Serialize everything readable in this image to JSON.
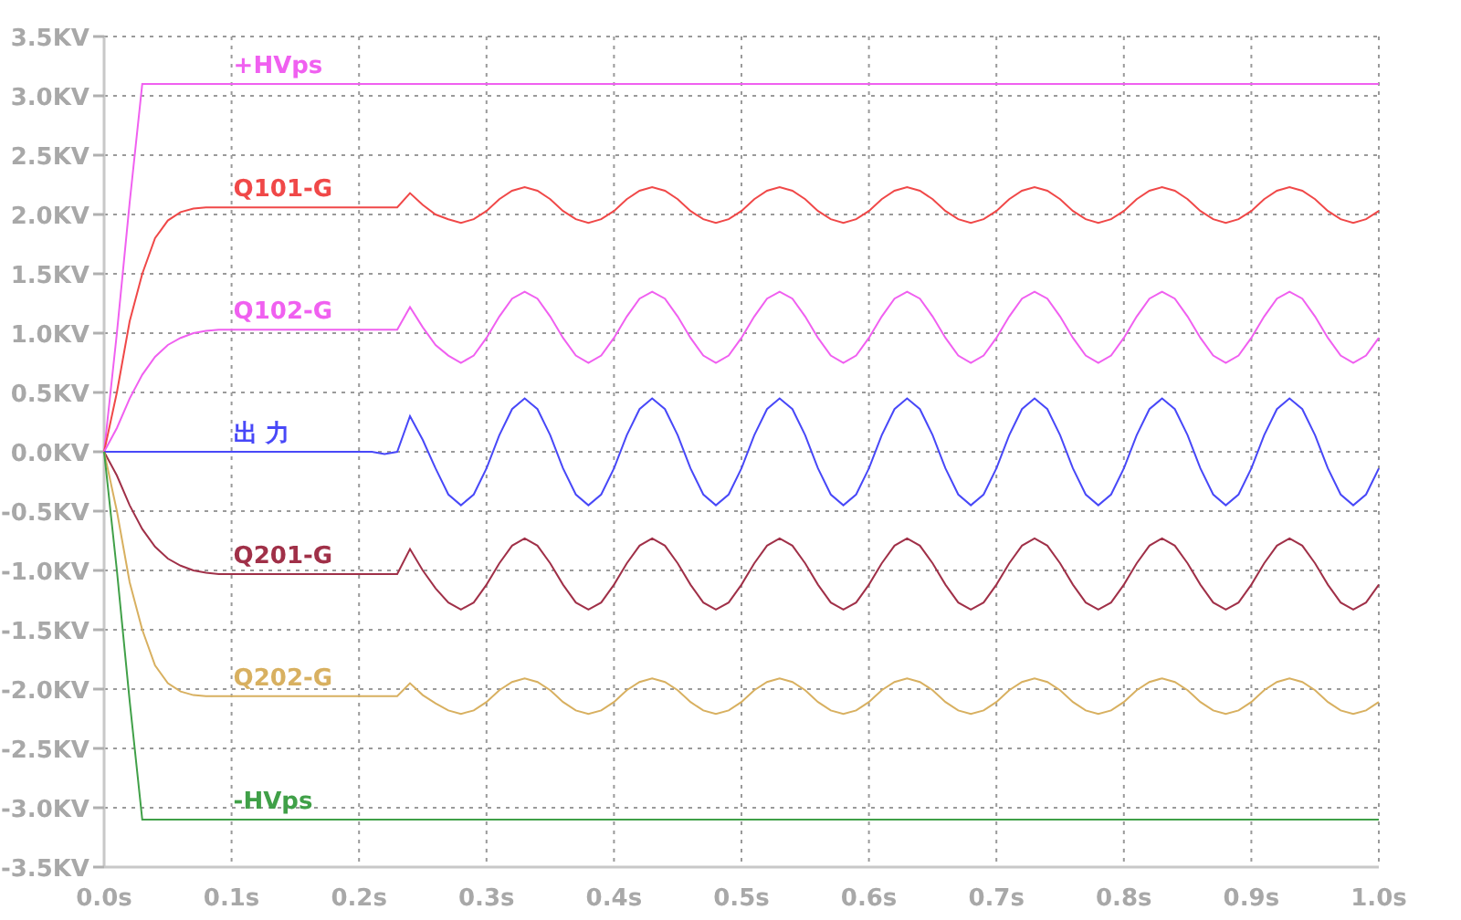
{
  "plot": {
    "chart_data": {
      "type": "line",
      "x": [
        0,
        0.01,
        0.02,
        0.03,
        0.04,
        0.05,
        0.06,
        0.07,
        0.08,
        0.09,
        0.1,
        0.11,
        0.12,
        0.13,
        0.14,
        0.15,
        0.16,
        0.17,
        0.18,
        0.19,
        0.2,
        0.21,
        0.22,
        0.23,
        0.24,
        0.25,
        0.26,
        0.27,
        0.28,
        0.29,
        0.3,
        0.31,
        0.32,
        0.33,
        0.34,
        0.35,
        0.36,
        0.37,
        0.38,
        0.39,
        0.4,
        0.41,
        0.42,
        0.43,
        0.44,
        0.45,
        0.46,
        0.47,
        0.48,
        0.49,
        0.5,
        0.51,
        0.52,
        0.53,
        0.54,
        0.55,
        0.56,
        0.57,
        0.58,
        0.59,
        0.6,
        0.61,
        0.62,
        0.63,
        0.64,
        0.65,
        0.66,
        0.67,
        0.68,
        0.69,
        0.7,
        0.71,
        0.72,
        0.73,
        0.74,
        0.75,
        0.76,
        0.77,
        0.78,
        0.79,
        0.8,
        0.81,
        0.82,
        0.83,
        0.84,
        0.85,
        0.86,
        0.87,
        0.88,
        0.89,
        0.9,
        0.91,
        0.92,
        0.93,
        0.94,
        0.95,
        0.96,
        0.97,
        0.98,
        0.99,
        1.0
      ],
      "series": [
        {
          "name": "+HVps",
          "color": "#f060f0",
          "values": [
            0,
            1.0,
            2.1,
            3.1,
            3.1,
            3.1,
            3.1,
            3.1,
            3.1,
            3.1,
            3.1,
            3.1,
            3.1,
            3.1,
            3.1,
            3.1,
            3.1,
            3.1,
            3.1,
            3.1,
            3.1,
            3.1,
            3.1,
            3.1,
            3.1,
            3.1,
            3.1,
            3.1,
            3.1,
            3.1,
            3.1,
            3.1,
            3.1,
            3.1,
            3.1,
            3.1,
            3.1,
            3.1,
            3.1,
            3.1,
            3.1,
            3.1,
            3.1,
            3.1,
            3.1,
            3.1,
            3.1,
            3.1,
            3.1,
            3.1,
            3.1,
            3.1,
            3.1,
            3.1,
            3.1,
            3.1,
            3.1,
            3.1,
            3.1,
            3.1,
            3.1,
            3.1,
            3.1,
            3.1,
            3.1,
            3.1,
            3.1,
            3.1,
            3.1,
            3.1,
            3.1,
            3.1,
            3.1,
            3.1,
            3.1,
            3.1,
            3.1,
            3.1,
            3.1,
            3.1,
            3.1,
            3.1,
            3.1,
            3.1,
            3.1,
            3.1,
            3.1,
            3.1,
            3.1,
            3.1,
            3.1,
            3.1,
            3.1,
            3.1,
            3.1,
            3.1,
            3.1,
            3.1,
            3.1,
            3.1,
            3.1
          ]
        },
        {
          "name": "Q101-G",
          "color": "#f04848",
          "values": [
            0,
            0.5,
            1.1,
            1.5,
            1.8,
            1.95,
            2.02,
            2.05,
            2.06,
            2.06,
            2.06,
            2.06,
            2.06,
            2.06,
            2.06,
            2.06,
            2.06,
            2.06,
            2.06,
            2.06,
            2.06,
            2.06,
            2.06,
            2.06,
            2.18,
            2.08,
            2.0,
            1.96,
            1.93,
            1.96,
            2.03,
            2.13,
            2.2,
            2.23,
            2.2,
            2.13,
            2.03,
            1.96,
            1.93,
            1.96,
            2.03,
            2.13,
            2.2,
            2.23,
            2.2,
            2.13,
            2.03,
            1.96,
            1.93,
            1.96,
            2.03,
            2.13,
            2.2,
            2.23,
            2.2,
            2.13,
            2.03,
            1.96,
            1.93,
            1.96,
            2.03,
            2.13,
            2.2,
            2.23,
            2.2,
            2.13,
            2.03,
            1.96,
            1.93,
            1.96,
            2.03,
            2.13,
            2.2,
            2.23,
            2.2,
            2.13,
            2.03,
            1.96,
            1.93,
            1.96,
            2.03,
            2.13,
            2.2,
            2.23,
            2.2,
            2.13,
            2.03,
            1.96,
            1.93,
            1.96,
            2.03,
            2.13,
            2.2,
            2.23,
            2.2,
            2.13,
            2.03,
            1.96,
            1.93,
            1.96,
            2.03
          ]
        },
        {
          "name": "Q102-G",
          "color": "#f060f0",
          "values": [
            0,
            0.2,
            0.45,
            0.65,
            0.8,
            0.9,
            0.96,
            1.0,
            1.02,
            1.03,
            1.03,
            1.03,
            1.03,
            1.03,
            1.03,
            1.03,
            1.03,
            1.03,
            1.03,
            1.03,
            1.03,
            1.03,
            1.03,
            1.03,
            1.22,
            1.05,
            0.9,
            0.81,
            0.75,
            0.81,
            0.96,
            1.14,
            1.29,
            1.35,
            1.29,
            1.14,
            0.96,
            0.81,
            0.75,
            0.81,
            0.96,
            1.14,
            1.29,
            1.35,
            1.29,
            1.14,
            0.96,
            0.81,
            0.75,
            0.81,
            0.96,
            1.14,
            1.29,
            1.35,
            1.29,
            1.14,
            0.96,
            0.81,
            0.75,
            0.81,
            0.96,
            1.14,
            1.29,
            1.35,
            1.29,
            1.14,
            0.96,
            0.81,
            0.75,
            0.81,
            0.96,
            1.14,
            1.29,
            1.35,
            1.29,
            1.14,
            0.96,
            0.81,
            0.75,
            0.81,
            0.96,
            1.14,
            1.29,
            1.35,
            1.29,
            1.14,
            0.96,
            0.81,
            0.75,
            0.81,
            0.96,
            1.14,
            1.29,
            1.35,
            1.29,
            1.14,
            0.96,
            0.81,
            0.75,
            0.81,
            0.96
          ]
        },
        {
          "name": "出 力",
          "color": "#4848f8",
          "values": [
            0,
            0,
            0,
            0,
            0,
            0,
            0,
            0,
            0,
            0,
            0,
            0,
            0,
            0,
            0,
            0,
            0,
            0,
            0,
            0,
            0,
            0,
            -0.02,
            0,
            0.3,
            0.1,
            -0.14,
            -0.36,
            -0.45,
            -0.36,
            -0.14,
            0.14,
            0.36,
            0.45,
            0.36,
            0.14,
            -0.14,
            -0.36,
            -0.45,
            -0.36,
            -0.14,
            0.14,
            0.36,
            0.45,
            0.36,
            0.14,
            -0.14,
            -0.36,
            -0.45,
            -0.36,
            -0.14,
            0.14,
            0.36,
            0.45,
            0.36,
            0.14,
            -0.14,
            -0.36,
            -0.45,
            -0.36,
            -0.14,
            0.14,
            0.36,
            0.45,
            0.36,
            0.14,
            -0.14,
            -0.36,
            -0.45,
            -0.36,
            -0.14,
            0.14,
            0.36,
            0.45,
            0.36,
            0.14,
            -0.14,
            -0.36,
            -0.45,
            -0.36,
            -0.14,
            0.14,
            0.36,
            0.45,
            0.36,
            0.14,
            -0.14,
            -0.36,
            -0.45,
            -0.36,
            -0.14,
            0.14,
            0.36,
            0.45,
            0.36,
            0.14,
            -0.14,
            -0.36,
            -0.45,
            -0.36,
            -0.14
          ]
        },
        {
          "name": "Q201-G",
          "color": "#a03048",
          "values": [
            0,
            -0.2,
            -0.45,
            -0.65,
            -0.8,
            -0.9,
            -0.96,
            -1.0,
            -1.02,
            -1.03,
            -1.03,
            -1.03,
            -1.03,
            -1.03,
            -1.03,
            -1.03,
            -1.03,
            -1.03,
            -1.03,
            -1.03,
            -1.03,
            -1.03,
            -1.03,
            -1.03,
            -0.82,
            -1.0,
            -1.15,
            -1.27,
            -1.33,
            -1.27,
            -1.12,
            -0.94,
            -0.79,
            -0.73,
            -0.79,
            -0.94,
            -1.12,
            -1.27,
            -1.33,
            -1.27,
            -1.12,
            -0.94,
            -0.79,
            -0.73,
            -0.79,
            -0.94,
            -1.12,
            -1.27,
            -1.33,
            -1.27,
            -1.12,
            -0.94,
            -0.79,
            -0.73,
            -0.79,
            -0.94,
            -1.12,
            -1.27,
            -1.33,
            -1.27,
            -1.12,
            -0.94,
            -0.79,
            -0.73,
            -0.79,
            -0.94,
            -1.12,
            -1.27,
            -1.33,
            -1.27,
            -1.12,
            -0.94,
            -0.79,
            -0.73,
            -0.79,
            -0.94,
            -1.12,
            -1.27,
            -1.33,
            -1.27,
            -1.12,
            -0.94,
            -0.79,
            -0.73,
            -0.79,
            -0.94,
            -1.12,
            -1.27,
            -1.33,
            -1.27,
            -1.12,
            -0.94,
            -0.79,
            -0.73,
            -0.79,
            -0.94,
            -1.12,
            -1.27,
            -1.33,
            -1.27,
            -1.12
          ]
        },
        {
          "name": "Q202-G",
          "color": "#d8b060",
          "values": [
            0,
            -0.5,
            -1.1,
            -1.5,
            -1.8,
            -1.95,
            -2.02,
            -2.05,
            -2.06,
            -2.06,
            -2.06,
            -2.06,
            -2.06,
            -2.06,
            -2.06,
            -2.06,
            -2.06,
            -2.06,
            -2.06,
            -2.06,
            -2.06,
            -2.06,
            -2.06,
            -2.06,
            -1.95,
            -2.05,
            -2.12,
            -2.18,
            -2.21,
            -2.18,
            -2.11,
            -2.01,
            -1.94,
            -1.91,
            -1.94,
            -2.01,
            -2.11,
            -2.18,
            -2.21,
            -2.18,
            -2.11,
            -2.01,
            -1.94,
            -1.91,
            -1.94,
            -2.01,
            -2.11,
            -2.18,
            -2.21,
            -2.18,
            -2.11,
            -2.01,
            -1.94,
            -1.91,
            -1.94,
            -2.01,
            -2.11,
            -2.18,
            -2.21,
            -2.18,
            -2.11,
            -2.01,
            -1.94,
            -1.91,
            -1.94,
            -2.01,
            -2.11,
            -2.18,
            -2.21,
            -2.18,
            -2.11,
            -2.01,
            -1.94,
            -1.91,
            -1.94,
            -2.01,
            -2.11,
            -2.18,
            -2.21,
            -2.18,
            -2.11,
            -2.01,
            -1.94,
            -1.91,
            -1.94,
            -2.01,
            -2.11,
            -2.18,
            -2.21,
            -2.18,
            -2.11,
            -2.01,
            -1.94,
            -1.91,
            -1.94,
            -2.01,
            -2.11,
            -2.18,
            -2.21,
            -2.18,
            -2.11
          ]
        },
        {
          "name": "-HVps",
          "color": "#40a048",
          "values": [
            0,
            -1.0,
            -2.1,
            -3.1,
            -3.1,
            -3.1,
            -3.1,
            -3.1,
            -3.1,
            -3.1,
            -3.1,
            -3.1,
            -3.1,
            -3.1,
            -3.1,
            -3.1,
            -3.1,
            -3.1,
            -3.1,
            -3.1,
            -3.1,
            -3.1,
            -3.1,
            -3.1,
            -3.1,
            -3.1,
            -3.1,
            -3.1,
            -3.1,
            -3.1,
            -3.1,
            -3.1,
            -3.1,
            -3.1,
            -3.1,
            -3.1,
            -3.1,
            -3.1,
            -3.1,
            -3.1,
            -3.1,
            -3.1,
            -3.1,
            -3.1,
            -3.1,
            -3.1,
            -3.1,
            -3.1,
            -3.1,
            -3.1,
            -3.1,
            -3.1,
            -3.1,
            -3.1,
            -3.1,
            -3.1,
            -3.1,
            -3.1,
            -3.1,
            -3.1,
            -3.1,
            -3.1,
            -3.1,
            -3.1,
            -3.1,
            -3.1,
            -3.1,
            -3.1,
            -3.1,
            -3.1,
            -3.1,
            -3.1,
            -3.1,
            -3.1,
            -3.1,
            -3.1,
            -3.1,
            -3.1,
            -3.1,
            -3.1,
            -3.1,
            -3.1,
            -3.1,
            -3.1,
            -3.1,
            -3.1,
            -3.1,
            -3.1,
            -3.1,
            -3.1,
            -3.1,
            -3.1,
            -3.1,
            -3.1,
            -3.1,
            -3.1,
            -3.1,
            -3.1,
            -3.1,
            -3.1,
            -3.1
          ]
        }
      ],
      "xlim": [
        0,
        1
      ],
      "ylim": [
        -3.5,
        3.5
      ],
      "xticks": [
        {
          "value": 0,
          "label": "0.0s"
        },
        {
          "value": 0.1,
          "label": "0.1s"
        },
        {
          "value": 0.2,
          "label": "0.2s"
        },
        {
          "value": 0.3,
          "label": "0.3s"
        },
        {
          "value": 0.4,
          "label": "0.4s"
        },
        {
          "value": 0.5,
          "label": "0.5s"
        },
        {
          "value": 0.6,
          "label": "0.6s"
        },
        {
          "value": 0.7,
          "label": "0.7s"
        },
        {
          "value": 0.8,
          "label": "0.8s"
        },
        {
          "value": 0.9,
          "label": "0.9s"
        },
        {
          "value": 1.0,
          "label": "1.0s"
        }
      ],
      "yticks": [
        {
          "value": 3.5,
          "label": "3.5KV"
        },
        {
          "value": 3.0,
          "label": "3.0KV"
        },
        {
          "value": 2.5,
          "label": "2.5KV"
        },
        {
          "value": 2.0,
          "label": "2.0KV"
        },
        {
          "value": 1.5,
          "label": "1.5KV"
        },
        {
          "value": 1.0,
          "label": "1.0KV"
        },
        {
          "value": 0.5,
          "label": "0.5KV"
        },
        {
          "value": 0,
          "label": "0.0KV"
        },
        {
          "value": -0.5,
          "label": "-0.5KV"
        },
        {
          "value": -1.0,
          "label": "-1.0KV"
        },
        {
          "value": -1.5,
          "label": "-1.5KV"
        },
        {
          "value": -2.0,
          "label": "-2.0KV"
        },
        {
          "value": -2.5,
          "label": "-2.5KV"
        },
        {
          "value": -3.0,
          "label": "-3.0KV"
        },
        {
          "value": -3.5,
          "label": "-3.5KV"
        }
      ],
      "grid": true
    }
  }
}
